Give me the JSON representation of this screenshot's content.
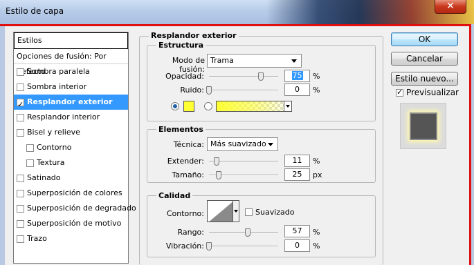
{
  "window": {
    "title": "Estilo de capa",
    "close_glyph": "✕"
  },
  "style_list": {
    "header": "Estilos",
    "blend_options": "Opciones de fusión: Por defecto",
    "items": [
      {
        "label": "Sombra paralela",
        "checked": false
      },
      {
        "label": "Sombra interior",
        "checked": false
      },
      {
        "label": "Resplandor exterior",
        "checked": true
      },
      {
        "label": "Resplandor interior",
        "checked": false
      },
      {
        "label": "Bisel y relieve",
        "checked": false
      },
      {
        "label": "Contorno",
        "checked": false
      },
      {
        "label": "Textura",
        "checked": false
      },
      {
        "label": "Satinado",
        "checked": false
      },
      {
        "label": "Superposición de colores",
        "checked": false
      },
      {
        "label": "Superposición de degradado",
        "checked": false
      },
      {
        "label": "Superposición de motivo",
        "checked": false
      },
      {
        "label": "Trazo",
        "checked": false
      }
    ]
  },
  "buttons": {
    "ok": "OK",
    "cancel": "Cancelar",
    "new_style": "Estilo nuevo...",
    "preview_label": "Previsualizar",
    "preview_checked": true
  },
  "panel": {
    "title": "Resplandor exterior",
    "structure": {
      "title": "Estructura",
      "blend_mode_label": "Modo de fusión:",
      "blend_mode_value": "Trama",
      "opacity_label": "Opacidad:",
      "opacity_value": "75",
      "opacity_unit": "%",
      "noise_label": "Ruido:",
      "noise_value": "0",
      "noise_unit": "%",
      "color": "#ffff33",
      "color_mode": "solid"
    },
    "elements": {
      "title": "Elementos",
      "technique_label": "Técnica:",
      "technique_value": "Más suavizado",
      "spread_label": "Extender:",
      "spread_value": "11",
      "spread_unit": "%",
      "size_label": "Tamaño:",
      "size_value": "25",
      "size_unit": "px"
    },
    "quality": {
      "title": "Calidad",
      "contour_label": "Contorno:",
      "antialias_label": "Suavizado",
      "antialias_checked": false,
      "range_label": "Rango:",
      "range_value": "57",
      "range_unit": "%",
      "jitter_label": "Vibración:",
      "jitter_value": "0",
      "jitter_unit": "%"
    }
  }
}
